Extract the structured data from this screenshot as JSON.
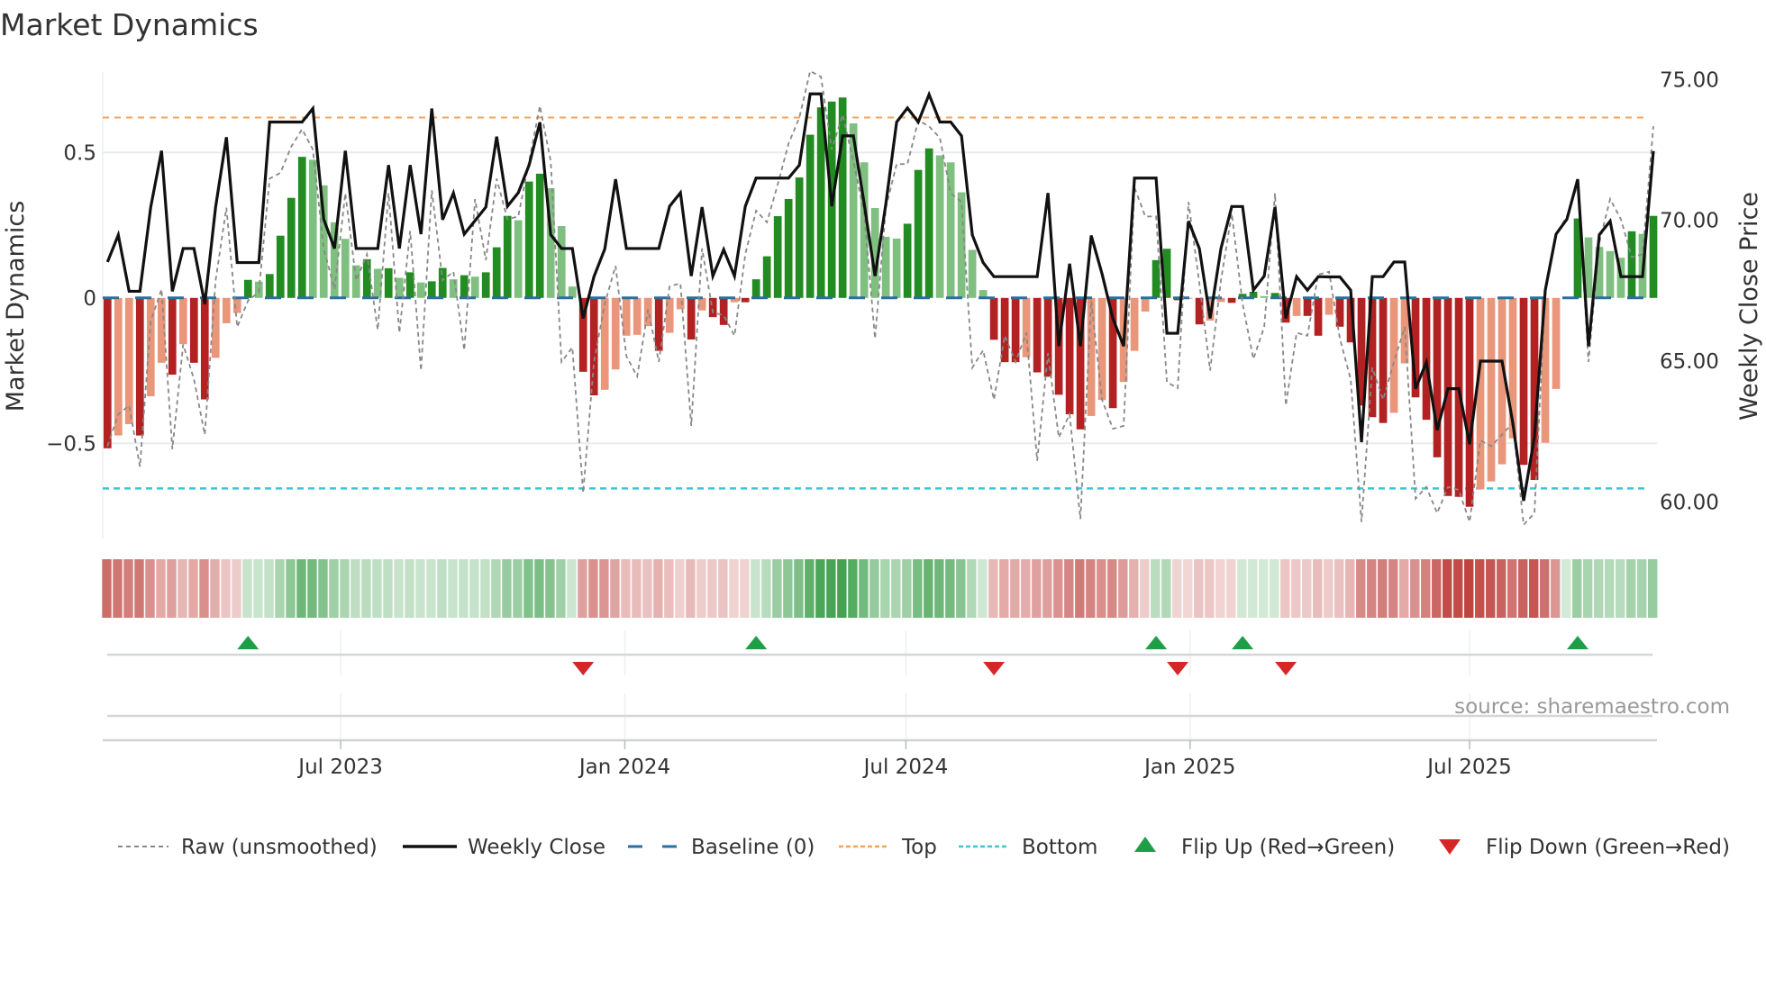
{
  "title": "Market Dynamics",
  "source": "source: sharemaestro.com",
  "colors": {
    "green_dark": "#228b22",
    "green_light": "#7fbf7f",
    "red_dark": "#b22222",
    "red_light": "#e9967a",
    "close": "#111111",
    "raw": "#888888",
    "baseline": "#2a6f9e",
    "top": "#f2a35e",
    "bottom": "#3cc5d8",
    "flip_up": "#1f9e48",
    "flip_down": "#d62728"
  },
  "chart_data": {
    "type": "bar",
    "title": "Market Dynamics",
    "ylabel": "Market Dynamics",
    "ylabel_right": "Weekly Close Price",
    "start_week": "2023-01-31",
    "ylim": [
      -0.77,
      0.8
    ],
    "ylim_right": [
      59.4,
      75.4
    ],
    "top_level": 0.62,
    "bottom_level": -0.655,
    "baseline": 0,
    "left_ticks": [
      {
        "value": 0.5,
        "label": "0.5"
      },
      {
        "value": 0,
        "label": "0"
      },
      {
        "value": -0.5,
        "label": "−0.5"
      }
    ],
    "right_ticks": [
      {
        "value": 75,
        "label": "75.00"
      },
      {
        "value": 70,
        "label": "70.00"
      },
      {
        "value": 65,
        "label": "65.00"
      },
      {
        "value": 60,
        "label": "60.00"
      }
    ],
    "x_ticks": [
      {
        "date": "2023-07-01",
        "label": "Jul 2023"
      },
      {
        "date": "2024-01-01",
        "label": "Jan 2024"
      },
      {
        "date": "2024-07-01",
        "label": "Jul 2024"
      },
      {
        "date": "2025-01-01",
        "label": "Jan 2025"
      },
      {
        "date": "2025-07-01",
        "label": "Jul 2025"
      }
    ],
    "series": [
      {
        "name": "Market Dynamics (smoothed)",
        "values": [
          -0.517,
          -0.473,
          -0.434,
          -0.473,
          -0.338,
          -0.223,
          -0.264,
          -0.159,
          -0.223,
          -0.349,
          -0.206,
          -0.087,
          -0.052,
          0.062,
          0.056,
          0.082,
          0.214,
          0.344,
          0.485,
          0.475,
          0.387,
          0.26,
          0.203,
          0.112,
          0.133,
          0.1,
          0.102,
          0.069,
          0.088,
          0.053,
          0.057,
          0.103,
          0.064,
          0.078,
          0.073,
          0.088,
          0.174,
          0.282,
          0.267,
          0.4,
          0.427,
          0.377,
          0.247,
          0.039,
          -0.254,
          -0.335,
          -0.316,
          -0.246,
          -0.13,
          -0.127,
          -0.097,
          -0.182,
          -0.12,
          -0.039,
          -0.143,
          -0.043,
          -0.066,
          -0.093,
          -0.015,
          -0.015,
          0.064,
          0.143,
          0.281,
          0.34,
          0.414,
          0.561,
          0.655,
          0.675,
          0.689,
          0.6,
          0.466,
          0.309,
          0.21,
          0.204,
          0.255,
          0.44,
          0.514,
          0.49,
          0.466,
          0.363,
          0.165,
          0.027,
          -0.144,
          -0.221,
          -0.221,
          -0.204,
          -0.256,
          -0.271,
          -0.333,
          -0.4,
          -0.452,
          -0.406,
          -0.351,
          -0.379,
          -0.289,
          -0.182,
          -0.047,
          0.13,
          0.169,
          -0.008,
          -0.003,
          -0.091,
          -0.078,
          -0.014,
          -0.017,
          0.014,
          0.021,
          0.006,
          0.017,
          -0.085,
          -0.062,
          -0.062,
          -0.13,
          -0.058,
          -0.099,
          -0.153,
          -0.37,
          -0.41,
          -0.43,
          -0.395,
          -0.225,
          -0.342,
          -0.419,
          -0.548,
          -0.681,
          -0.684,
          -0.718,
          -0.658,
          -0.631,
          -0.572,
          -0.483,
          -0.574,
          -0.626,
          -0.498,
          -0.313,
          0,
          0.273,
          0.208,
          0.175,
          0.161,
          0.138,
          0.229,
          0.22,
          0.282
        ]
      },
      {
        "name": "Raw (unsmoothed)",
        "values": [
          -0.51,
          -0.4,
          -0.37,
          -0.58,
          -0.08,
          0.03,
          -0.52,
          -0.16,
          -0.28,
          -0.47,
          0.06,
          0.31,
          -0.1,
          -0.01,
          0.02,
          0.41,
          0.43,
          0.52,
          0.58,
          0.51,
          0.17,
          0.03,
          0.36,
          0.06,
          0.15,
          -0.11,
          0.36,
          -0.12,
          0.23,
          -0.25,
          0.37,
          0.06,
          0.09,
          -0.18,
          0.34,
          0.13,
          0.41,
          0.27,
          0.28,
          0.47,
          0.66,
          0.47,
          -0.22,
          -0.17,
          -0.67,
          -0.22,
          -0.02,
          0.11,
          -0.2,
          -0.27,
          -0.04,
          -0.22,
          0.04,
          0.05,
          -0.44,
          0.17,
          -0.05,
          -0.06,
          -0.13,
          0.15,
          0.3,
          0.26,
          0.39,
          0.53,
          0.62,
          0.78,
          0.76,
          0.51,
          0.63,
          0.47,
          0.29,
          -0.14,
          0.31,
          0.46,
          0.46,
          0.61,
          0.59,
          0.55,
          0.36,
          0.33,
          -0.24,
          -0.18,
          -0.35,
          -0.13,
          -0.22,
          -0.12,
          -0.56,
          -0.19,
          -0.48,
          -0.4,
          -0.76,
          -0.01,
          -0.35,
          -0.45,
          -0.44,
          0.38,
          0.28,
          0.28,
          -0.29,
          -0.31,
          0.33,
          0.05,
          -0.25,
          0.06,
          0.29,
          -0.02,
          -0.21,
          -0.1,
          0.36,
          -0.37,
          -0.12,
          -0.13,
          0.08,
          0.09,
          -0.14,
          -0.28,
          -0.77,
          -0.24,
          -0.35,
          -0.22,
          -0.1,
          -0.69,
          -0.65,
          -0.74,
          -0.65,
          -0.66,
          -0.77,
          -0.49,
          -0.51,
          -0.47,
          -0.43,
          -0.78,
          -0.74,
          0.02,
          0.22,
          0.28,
          0.39,
          -0.22,
          0.19,
          0.34,
          0.27,
          0.14,
          0.15,
          0.59
        ]
      },
      {
        "name": "Weekly Close",
        "axis": "right",
        "values": [
          68.52,
          69.48,
          67.48,
          67.48,
          70.47,
          72.47,
          67.48,
          69.0,
          69.0,
          67.03,
          70.47,
          72.95,
          68.5,
          68.5,
          68.5,
          73.49,
          73.49,
          73.49,
          73.49,
          73.97,
          70.04,
          69.0,
          72.47,
          69.0,
          69.0,
          69.0,
          71.96,
          69.0,
          71.96,
          69.51,
          73.97,
          70.02,
          70.97,
          69.51,
          69.99,
          70.47,
          72.97,
          70.5,
          70.98,
          71.96,
          73.48,
          69.49,
          69.0,
          69.0,
          66.52,
          68.0,
          68.98,
          71.46,
          69.0,
          69.0,
          69.0,
          69.0,
          70.5,
          70.98,
          68.02,
          70.47,
          68.02,
          68.96,
          68.02,
          70.5,
          71.5,
          71.5,
          71.5,
          71.5,
          71.96,
          74.49,
          74.49,
          70.5,
          73.0,
          73.0,
          70.58,
          68.02,
          70.58,
          73.49,
          73.99,
          73.49,
          74.47,
          73.49,
          73.49,
          73.0,
          69.48,
          68.5,
          68.0,
          68.0,
          68.0,
          68.0,
          68.0,
          70.97,
          65.53,
          68.46,
          65.53,
          69.46,
          68.1,
          66.52,
          65.53,
          71.5,
          71.5,
          71.5,
          65.99,
          65.99,
          69.97,
          69.0,
          66.52,
          69.0,
          70.49,
          70.49,
          67.52,
          68.02,
          70.47,
          66.52,
          68.0,
          67.52,
          68.0,
          67.99,
          67.99,
          67.52,
          62.12,
          68.0,
          68.0,
          68.52,
          68.52,
          64.02,
          64.96,
          62.55,
          64.02,
          64.02,
          62.05,
          65.0,
          65.0,
          65.0,
          62.8,
          60.04,
          62.31,
          67.52,
          69.51,
          70.04,
          71.46,
          65.53,
          69.49,
          69.97,
          68.0,
          68.0,
          68.0,
          72.46
        ]
      }
    ],
    "flip_up_weeks": [
      13,
      60,
      97,
      105,
      136
    ],
    "flip_down_weeks": [
      44,
      82,
      99,
      109
    ],
    "legend_position": "bottom",
    "legend": [
      {
        "key": "raw",
        "label": "Raw (unsmoothed)"
      },
      {
        "key": "close",
        "label": "Weekly Close"
      },
      {
        "key": "baseline",
        "label": "Baseline (0)"
      },
      {
        "key": "top",
        "label": "Top"
      },
      {
        "key": "bottom",
        "label": "Bottom"
      },
      {
        "key": "flip_up",
        "label": "Flip Up (Red→Green)"
      },
      {
        "key": "flip_down",
        "label": "Flip Down (Green→Red)"
      }
    ]
  }
}
